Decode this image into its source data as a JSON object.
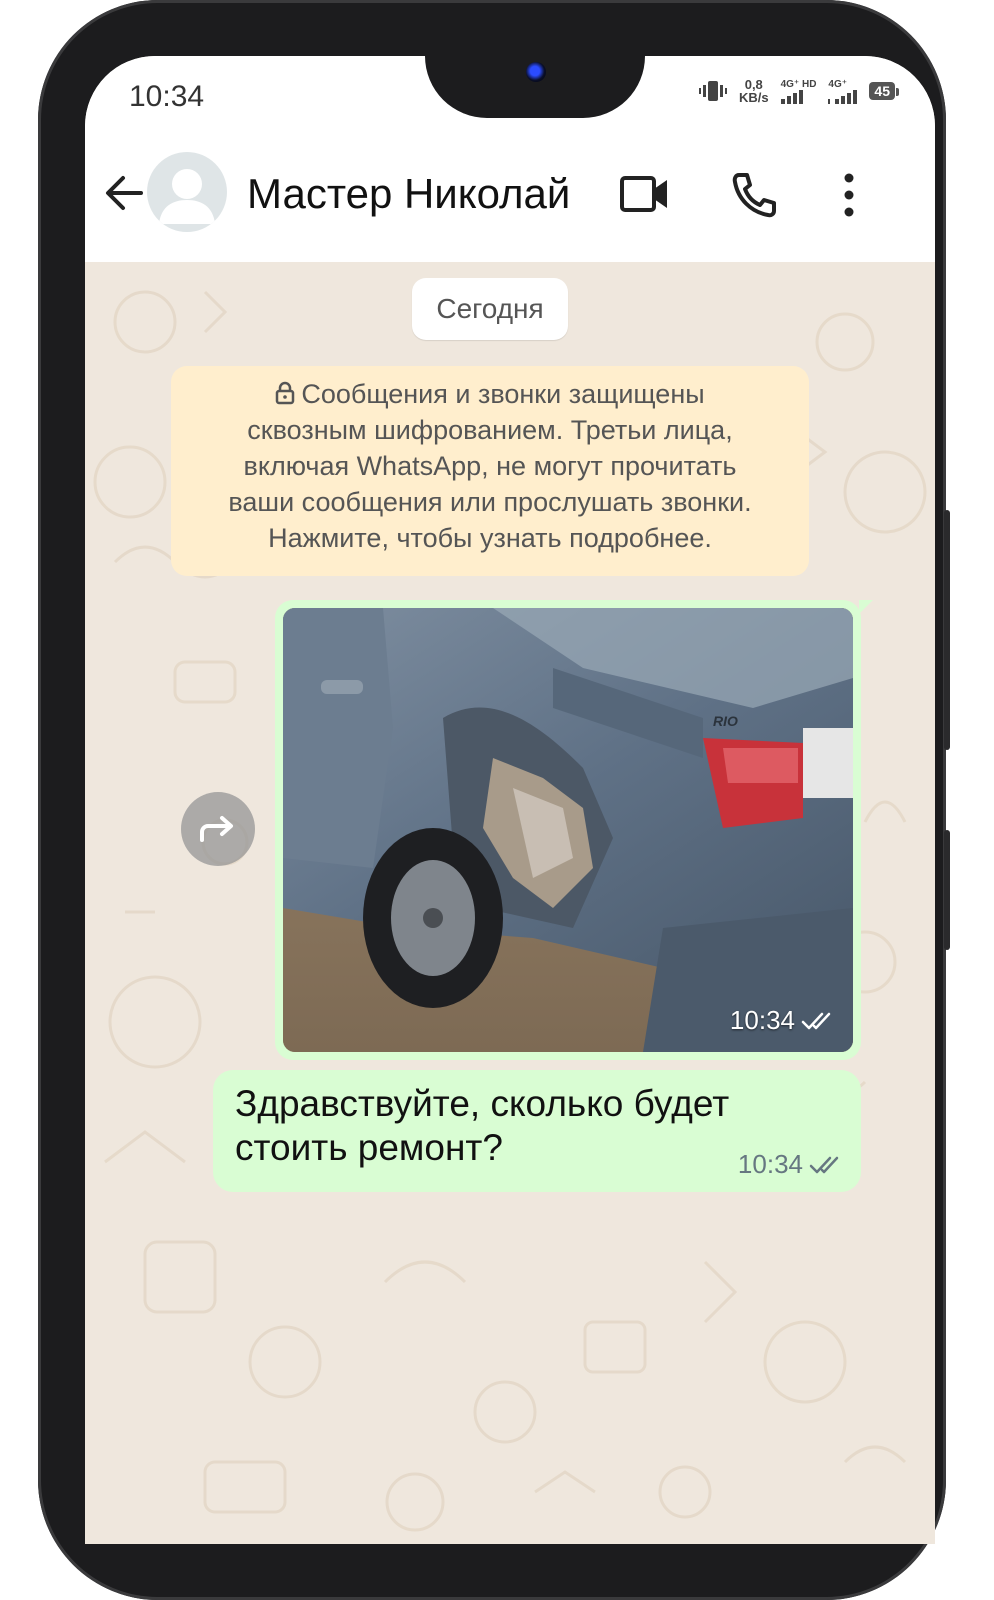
{
  "status_bar": {
    "time": "10:34",
    "net_speed_value": "0,8",
    "net_speed_unit": "KB/s",
    "sim1_label": "4G⁺ HD",
    "sim2_label": "4G⁺",
    "battery": "45"
  },
  "header": {
    "contact_name": "Мастер Николай",
    "icons": [
      "back-arrow-icon",
      "avatar",
      "video-call-icon",
      "voice-call-icon",
      "more-options-icon"
    ]
  },
  "chat": {
    "date_chip": "Сегодня",
    "encryption_notice": {
      "line1": "Сообщения и звонки защищены",
      "line2": "сквозным шифрованием. Третьи лица,",
      "line3": "включая WhatsApp, не могут прочитать",
      "line4": "ваши сообщения или прослушать звонки.",
      "line5": "Нажмите, чтобы узнать подробнее."
    },
    "messages": [
      {
        "type": "image",
        "badge": "RIO",
        "time": "10:34",
        "status": "read"
      },
      {
        "type": "text",
        "line1": "Здравствуйте, сколько будет",
        "line2": "стоить ремонт?",
        "time": "10:34",
        "status": "read"
      }
    ]
  },
  "colors": {
    "chat_background": "#efe7dd",
    "outgoing_bubble": "#d9fdd3",
    "system_notice": "#ffeecd",
    "read_ticks": "#667781"
  }
}
